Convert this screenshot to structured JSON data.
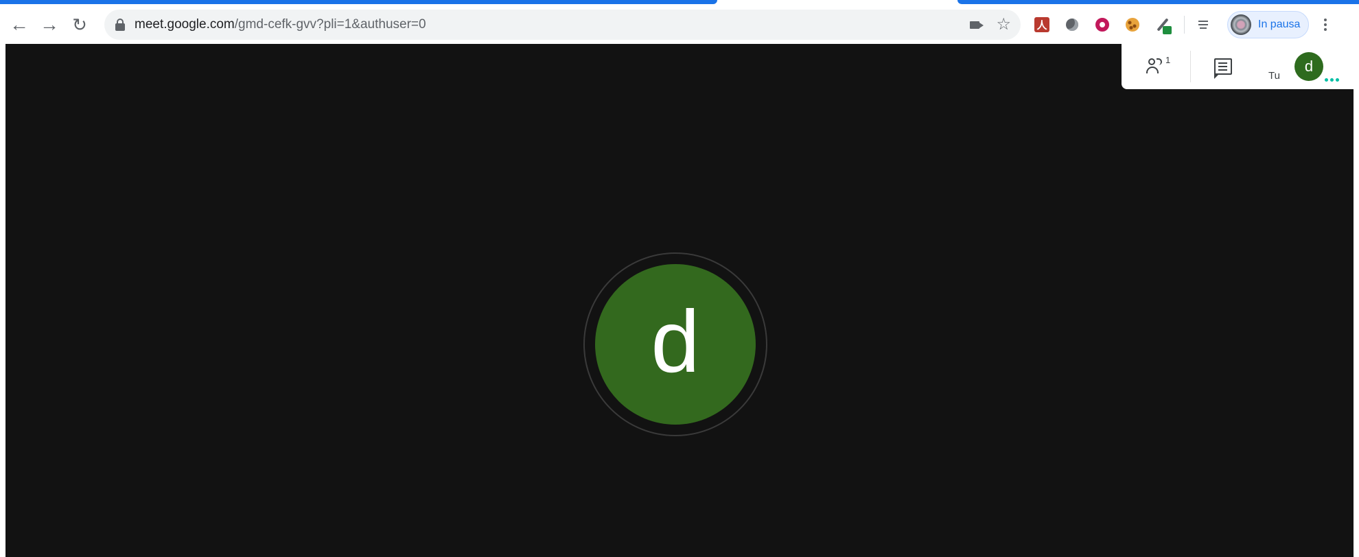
{
  "browser": {
    "url_host": "meet.google.com",
    "url_path": "/gmd-cefk-gvv?pli=1&authuser=0",
    "profile_label": "In pausa",
    "nav_icons": {
      "back": "arrow-left-icon",
      "forward": "arrow-right-icon",
      "reload": "reload-icon"
    },
    "omnibox_icons": [
      "lock-icon",
      "camera-icon",
      "star-icon"
    ],
    "extensions": [
      "pdf-extension-icon",
      "circle-extension-icon",
      "donut-extension-icon",
      "cookie-extension-icon",
      "color-picker-extension-icon"
    ],
    "accent_color": "#1a73e8"
  },
  "meet": {
    "participants_count": "1",
    "self_label": "Tu",
    "self_initial": "d",
    "main_initial": "d",
    "avatar_color": "#33691e",
    "background_color": "#121212",
    "panel_icons": [
      "participants-icon",
      "chat-icon"
    ]
  }
}
